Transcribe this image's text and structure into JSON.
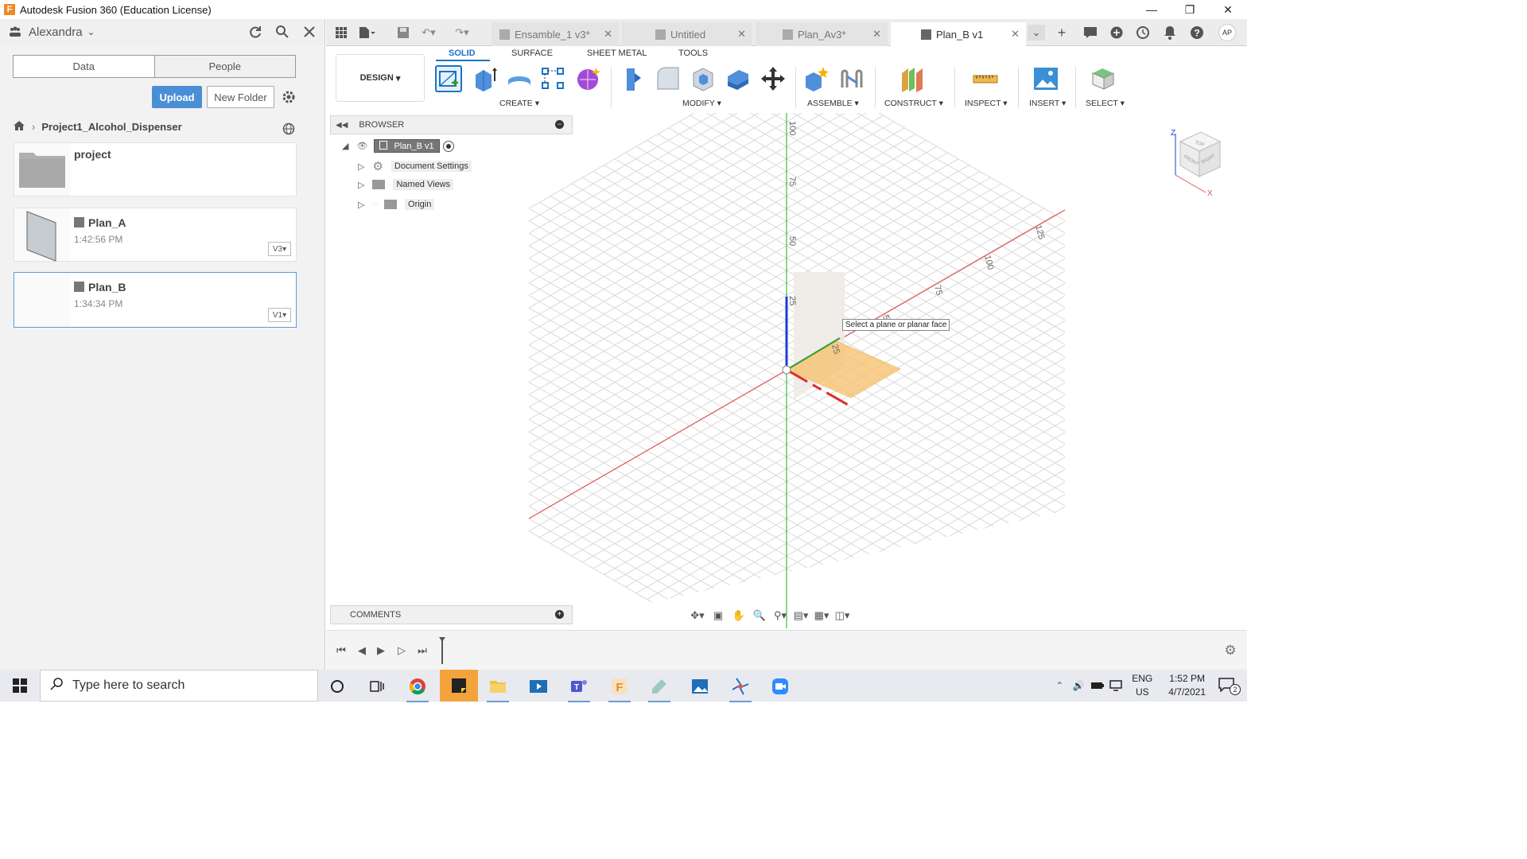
{
  "window": {
    "title": "Autodesk Fusion 360 (Education License)",
    "logo": "F"
  },
  "left_panel": {
    "user": "Alexandra",
    "tabs": {
      "data": "Data",
      "people": "People"
    },
    "upload": "Upload",
    "new_folder": "New Folder",
    "breadcrumb": "Project1_Alcohol_Dispenser",
    "items": [
      {
        "name": "project",
        "time": "",
        "version": ""
      },
      {
        "name": "Plan_A",
        "time": "1:42:56 PM",
        "version": "V3"
      },
      {
        "name": "Plan_B",
        "time": "1:34:34 PM",
        "version": "V1"
      }
    ]
  },
  "doc_tabs": [
    {
      "label": "Ensamble_1 v3*"
    },
    {
      "label": "Untitled"
    },
    {
      "label": "Plan_Av3*"
    },
    {
      "label": "Plan_B v1"
    }
  ],
  "avatar": "AP",
  "ribbon": {
    "tabs": [
      "SOLID",
      "SURFACE",
      "SHEET METAL",
      "TOOLS"
    ],
    "workspace": "DESIGN",
    "groups": [
      "CREATE",
      "MODIFY",
      "ASSEMBLE",
      "CONSTRUCT",
      "INSPECT",
      "INSERT",
      "SELECT"
    ]
  },
  "browser": {
    "title": "BROWSER",
    "root": "Plan_B v1",
    "children": [
      "Document Settings",
      "Named Views",
      "Origin"
    ]
  },
  "comments": "COMMENTS",
  "viewport": {
    "tooltip": "Select a plane or planar face",
    "axis_ticks_v": [
      "100",
      "75",
      "50",
      "25"
    ],
    "axis_ticks_x": [
      "125",
      "100",
      "75",
      "50",
      "25"
    ],
    "viewcube": {
      "top": "TOP",
      "front": "FRONT",
      "right": "RIGHT",
      "z": "Z",
      "x": "X"
    }
  },
  "taskbar": {
    "search_placeholder": "Type here to search",
    "lang": "ENG",
    "region": "US",
    "time": "1:52 PM",
    "date": "4/7/2021",
    "notif": "2"
  },
  "colors": {
    "accent": "#1a73c8",
    "upload": "#4a8fd6",
    "x_axis": "#e05555",
    "y_axis": "#2e9e2e",
    "z_axis": "#1a3fd6",
    "plane": "#f7c06a"
  }
}
